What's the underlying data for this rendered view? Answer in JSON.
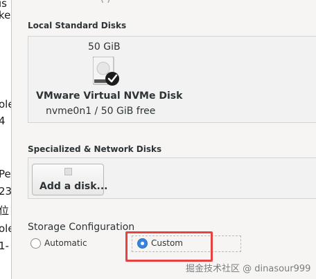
{
  "left_fragments": [
    "ıs",
    "ke",
    "ole",
    "4",
    "Pe",
    "23",
    "位",
    "ole",
    "1-"
  ],
  "top_cut_text": "( )",
  "local_disks": {
    "section_label": "Local Standard Disks",
    "disk": {
      "size": "50 GiB",
      "name": "VMware Virtual NVMe Disk",
      "detail": "nvme0n1   /   50 GiB free",
      "icon": "hard-disk-checked-icon"
    }
  },
  "specialized": {
    "section_label": "Specialized & Network Disks",
    "add_disk_label": "Add a disk..."
  },
  "storage_config": {
    "section_label": "Storage Configuration",
    "options": [
      {
        "label": "Automatic",
        "selected": false
      },
      {
        "label": "Custom",
        "selected": true
      }
    ]
  },
  "colors": {
    "accent": "#3584e4",
    "highlight": "#e8423f"
  },
  "watermark": "掘金技术社区 @ dinasour999"
}
